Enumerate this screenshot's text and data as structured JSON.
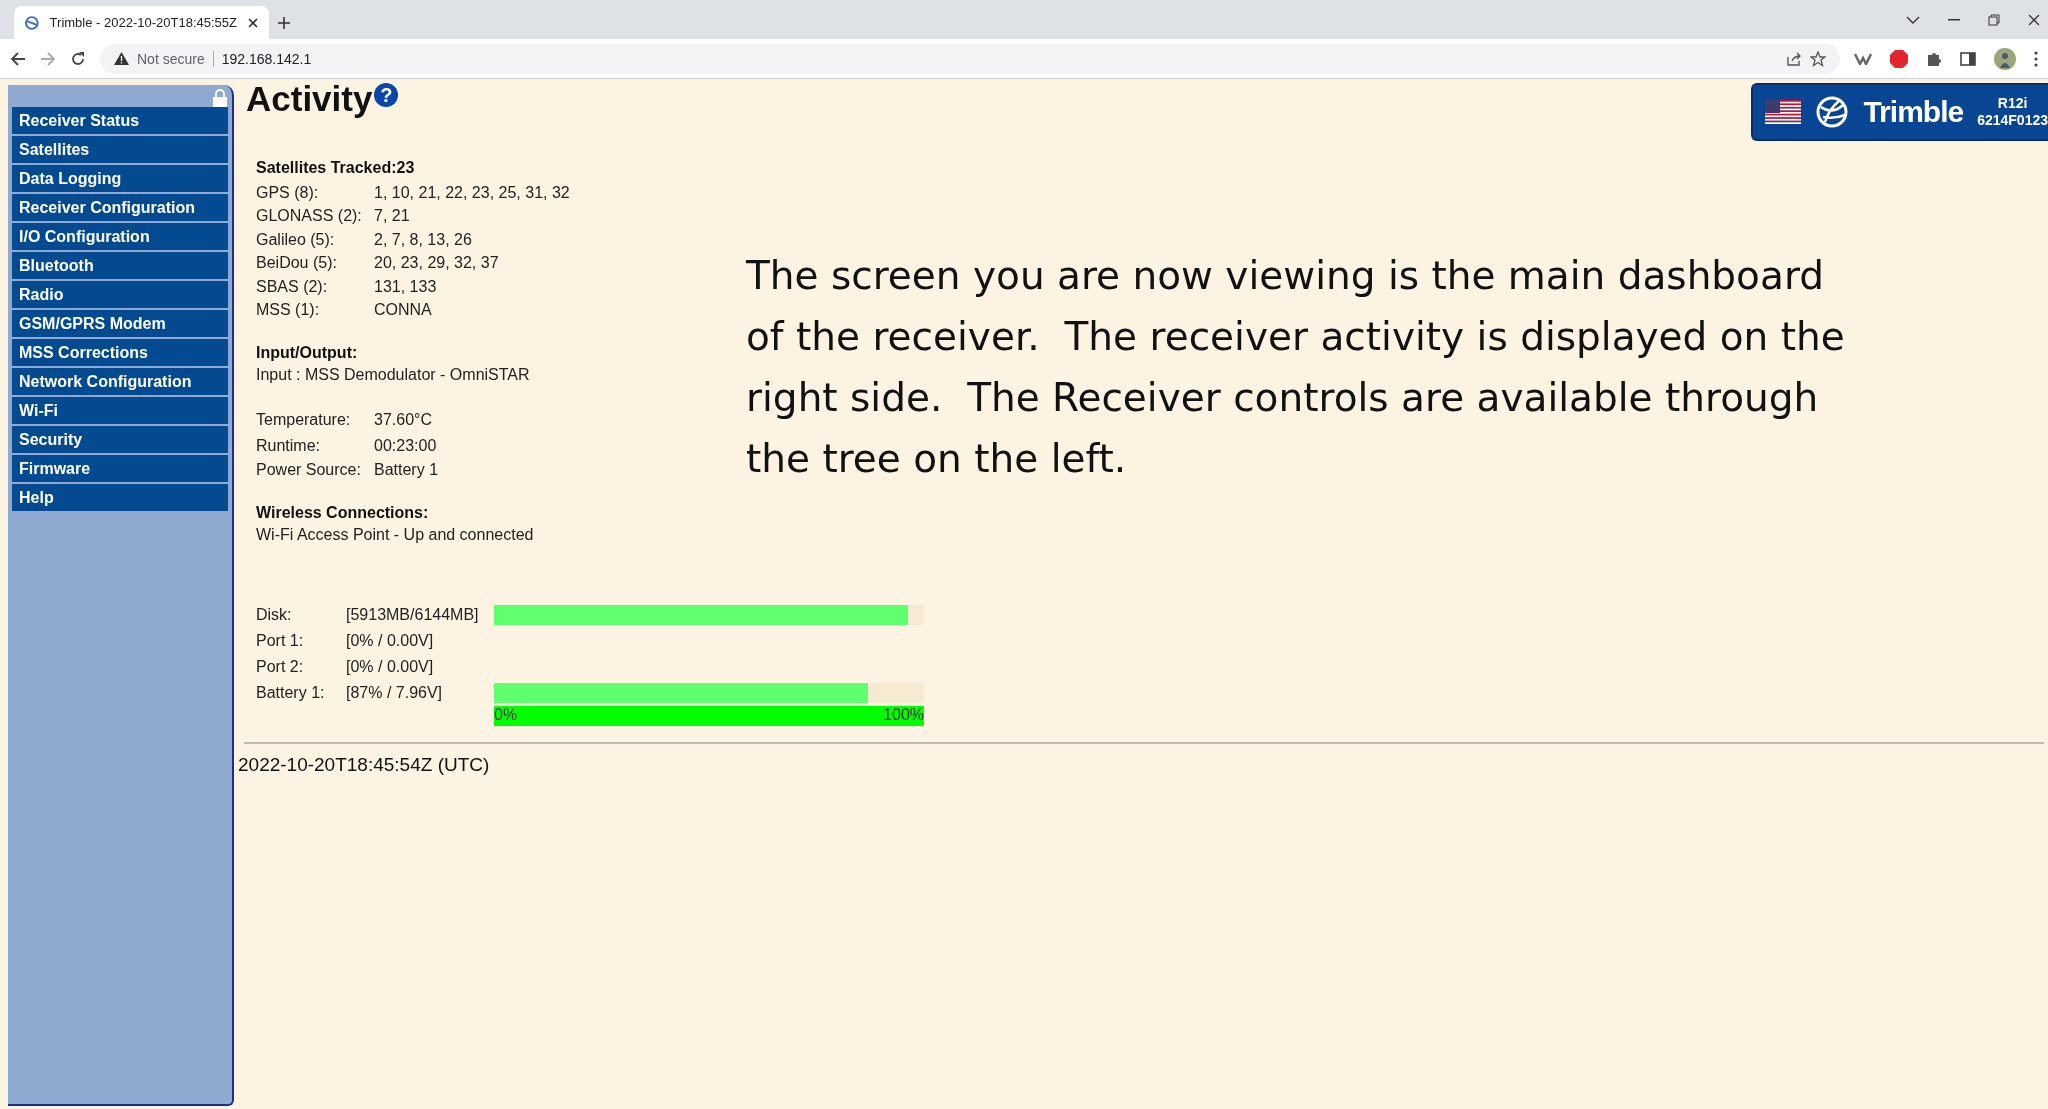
{
  "browser": {
    "tab_title": "Trimble - 2022-10-20T18:45:55Z",
    "security": "Not secure",
    "url": "192.168.142.1"
  },
  "sidebar": {
    "items": [
      "Receiver Status",
      "Satellites",
      "Data Logging",
      "Receiver Configuration",
      "I/O Configuration",
      "Bluetooth",
      "Radio",
      "GSM/GPRS Modem",
      "MSS Corrections",
      "Network Configuration",
      "Wi-Fi",
      "Security",
      "Firmware",
      "Help"
    ]
  },
  "page_title": "Activity",
  "help_icon": "?",
  "logo": {
    "brand": "Trimble",
    "model": "R12i",
    "serial": "6214F0123"
  },
  "satellites": {
    "heading": "Satellites Tracked:23",
    "rows": [
      {
        "label": "GPS (8):",
        "value": "1, 10, 21, 22, 23, 25, 31, 32"
      },
      {
        "label": "GLONASS (2):",
        "value": "7, 21"
      },
      {
        "label": "Galileo (5):",
        "value": "2, 7, 8, 13, 26"
      },
      {
        "label": "BeiDou (5):",
        "value": "20, 23, 29, 32, 37"
      },
      {
        "label": "SBAS (2):",
        "value": "131, 133"
      },
      {
        "label": "MSS (1):",
        "value": "CONNA"
      }
    ]
  },
  "io": {
    "heading": "Input/Output:",
    "text": "Input : MSS Demodulator - OmniSTAR"
  },
  "status": [
    {
      "label": "Temperature:",
      "value": "37.60°C"
    },
    {
      "label": "Runtime:",
      "value": "00:23:00"
    },
    {
      "label": "Power Source:",
      "value": "Battery 1"
    }
  ],
  "wireless": {
    "heading": "Wireless Connections:",
    "text": "Wi-Fi Access Point - Up and connected"
  },
  "meters": [
    {
      "label": "Disk:",
      "reading": "[5913MB/6144MB]",
      "kind": "bar",
      "level": 0.962
    },
    {
      "label": "Port 1:",
      "reading": "[0% / 0.00V]",
      "kind": "none"
    },
    {
      "label": "Port 2:",
      "reading": "[0% / 0.00V]",
      "kind": "none"
    },
    {
      "label": "Battery 1:",
      "reading": "[87% / 7.96V]",
      "kind": "bar",
      "level": 0.87
    }
  ],
  "scale": {
    "min": "0%",
    "max": "100%"
  },
  "timestamp": "2022-10-20T18:45:54Z (UTC)",
  "note": "The screen you are now viewing is the main dashboard of the receiver.  The receiver activity is displayed on the right side.  The Receiver controls are available through the tree on the left."
}
